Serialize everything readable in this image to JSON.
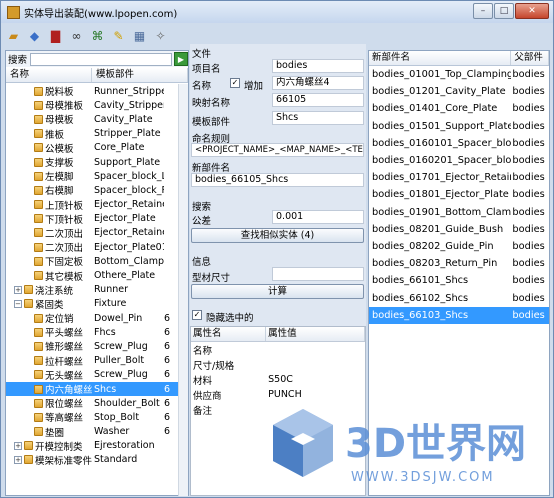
{
  "window": {
    "title": "实体导出装配(www.lpopen.com)"
  },
  "toolbar": {
    "icons": [
      "open-icon",
      "export-icon",
      "book-icon",
      "link-icon",
      "tree-icon",
      "rename-icon",
      "grid-icon",
      "help-icon"
    ]
  },
  "left": {
    "search_label": "搜索",
    "col_name": "名称",
    "col_part": "模板部件",
    "rows": [
      {
        "name": "脱料板",
        "part": "Runner_Stripper_",
        "extra": "",
        "sel": false,
        "indent": 2,
        "exp": ""
      },
      {
        "name": "母模推板",
        "part": "Cavity_Stripper_",
        "extra": "",
        "sel": false,
        "indent": 2,
        "exp": ""
      },
      {
        "name": "母模板",
        "part": "Cavity_Plate",
        "extra": "",
        "sel": false,
        "indent": 2,
        "exp": ""
      },
      {
        "name": "推板",
        "part": "Stripper_Plate",
        "extra": "",
        "sel": false,
        "indent": 2,
        "exp": ""
      },
      {
        "name": "公模板",
        "part": "Core_Plate",
        "extra": "",
        "sel": false,
        "indent": 2,
        "exp": ""
      },
      {
        "name": "支撑板",
        "part": "Support_Plate",
        "extra": "",
        "sel": false,
        "indent": 2,
        "exp": ""
      },
      {
        "name": "左模脚",
        "part": "Spacer_block_L",
        "extra": "",
        "sel": false,
        "indent": 2,
        "exp": ""
      },
      {
        "name": "右模脚",
        "part": "Spacer_block_R",
        "extra": "",
        "sel": false,
        "indent": 2,
        "exp": ""
      },
      {
        "name": "上顶针板",
        "part": "Ejector_Retaine",
        "extra": "",
        "sel": false,
        "indent": 2,
        "exp": ""
      },
      {
        "name": "下顶针板",
        "part": "Ejector_Plate",
        "extra": "",
        "sel": false,
        "indent": 2,
        "exp": ""
      },
      {
        "name": "二次顶出",
        "part": "Ejector_Retaine",
        "extra": "",
        "sel": false,
        "indent": 2,
        "exp": ""
      },
      {
        "name": "二次顶出",
        "part": "Ejector_Plate01",
        "extra": "",
        "sel": false,
        "indent": 2,
        "exp": ""
      },
      {
        "name": "下固定板",
        "part": "Bottom_Clampi",
        "extra": "",
        "sel": false,
        "indent": 2,
        "exp": ""
      },
      {
        "name": "其它模板",
        "part": "Othere_Plate",
        "extra": "",
        "sel": false,
        "indent": 2,
        "exp": ""
      },
      {
        "name": "浇注系统",
        "part": "Runner",
        "extra": "",
        "sel": false,
        "indent": 1,
        "exp": "+"
      },
      {
        "name": "紧固类",
        "part": "Fixture",
        "extra": "",
        "sel": false,
        "indent": 1,
        "exp": "−"
      },
      {
        "name": "定位销",
        "part": "Dowel_Pin",
        "extra": "6",
        "sel": false,
        "indent": 2,
        "exp": ""
      },
      {
        "name": "平头螺丝",
        "part": "Fhcs",
        "extra": "6",
        "sel": false,
        "indent": 2,
        "exp": ""
      },
      {
        "name": "锥形螺丝",
        "part": "Screw_Plug",
        "extra": "6",
        "sel": false,
        "indent": 2,
        "exp": ""
      },
      {
        "name": "拉杆螺丝",
        "part": "Puller_Bolt",
        "extra": "6",
        "sel": false,
        "indent": 2,
        "exp": ""
      },
      {
        "name": "无头螺丝",
        "part": "Screw_Plug",
        "extra": "6",
        "sel": false,
        "indent": 2,
        "exp": ""
      },
      {
        "name": "内六角螺丝",
        "part": "Shcs",
        "extra": "6",
        "sel": true,
        "indent": 2,
        "exp": ""
      },
      {
        "name": "限位螺丝",
        "part": "Shoulder_Bolt",
        "extra": "6",
        "sel": false,
        "indent": 2,
        "exp": ""
      },
      {
        "name": "等高螺丝",
        "part": "Stop_Bolt",
        "extra": "6",
        "sel": false,
        "indent": 2,
        "exp": ""
      },
      {
        "name": "垫圈",
        "part": "Washer",
        "extra": "6",
        "sel": false,
        "indent": 2,
        "exp": ""
      },
      {
        "name": "开模控制类",
        "part": "Ejrestoration",
        "extra": "",
        "sel": false,
        "indent": 1,
        "exp": "+"
      },
      {
        "name": "模架标准零件",
        "part": "Standard",
        "extra": "",
        "sel": false,
        "indent": 1,
        "exp": "+"
      }
    ]
  },
  "middle": {
    "file_section": "文件",
    "project_label": "项目名",
    "project_value": "bodies",
    "name_label": "名称",
    "add_label": "增加",
    "name_value": "内六角螺丝4",
    "map_label": "映射名称",
    "map_value": "66105",
    "template_label": "模板部件",
    "template_value": "Shcs",
    "rule_label": "命名规则",
    "rule_value": "<PROJECT_NAME>_<MAP_NAME>_<TEMPLA",
    "newname_label": "新部件名",
    "newname_value": "bodies_66105_Shcs",
    "search_section": "搜索",
    "tol_label": "公差",
    "tol_value": "0.001",
    "find_button": "查找相似实体 (4)",
    "info_section": "信息",
    "stock_label": "型材尺寸",
    "stock_value": "",
    "calc_button": "计算",
    "hide_label": "隐藏选中的",
    "prop_col1": "属性名",
    "prop_col2": "属性值",
    "props": [
      {
        "k": "名称",
        "v": ""
      },
      {
        "k": "尺寸/规格",
        "v": ""
      },
      {
        "k": "材料",
        "v": "S50C"
      },
      {
        "k": "供应商",
        "v": "PUNCH"
      },
      {
        "k": "备注",
        "v": ""
      }
    ]
  },
  "right": {
    "col_new": "新部件名",
    "col_parent": "父部件",
    "rows": [
      {
        "a": "bodies_01001_Top_Clamping_",
        "b": "bodies",
        "sel": false
      },
      {
        "a": "bodies_01201_Cavity_Plate",
        "b": "bodies",
        "sel": false
      },
      {
        "a": "bodies_01401_Core_Plate",
        "b": "bodies",
        "sel": false
      },
      {
        "a": "bodies_01501_Support_Plate",
        "b": "bodies",
        "sel": false
      },
      {
        "a": "bodies_0160101_Spacer_bloc",
        "b": "bodies",
        "sel": false
      },
      {
        "a": "bodies_0160201_Spacer_bloc",
        "b": "bodies",
        "sel": false
      },
      {
        "a": "bodies_01701_Ejector_Retaine",
        "b": "bodies",
        "sel": false
      },
      {
        "a": "bodies_01801_Ejector_Plate",
        "b": "bodies",
        "sel": false
      },
      {
        "a": "bodies_01901_Bottom_Clamp",
        "b": "bodies",
        "sel": false
      },
      {
        "a": "bodies_08201_Guide_Bush",
        "b": "bodies",
        "sel": false
      },
      {
        "a": "bodies_08202_Guide_Pin",
        "b": "bodies",
        "sel": false
      },
      {
        "a": "bodies_08203_Return_Pin",
        "b": "bodies",
        "sel": false
      },
      {
        "a": "bodies_66101_Shcs",
        "b": "bodies",
        "sel": false
      },
      {
        "a": "bodies_66102_Shcs",
        "b": "bodies",
        "sel": false
      },
      {
        "a": "bodies_66103_Shcs",
        "b": "bodies",
        "sel": true
      }
    ]
  },
  "watermark": {
    "text": "3D世界网",
    "url": "WWW.3DSJW.COM",
    "color": "#5b8fd6"
  }
}
